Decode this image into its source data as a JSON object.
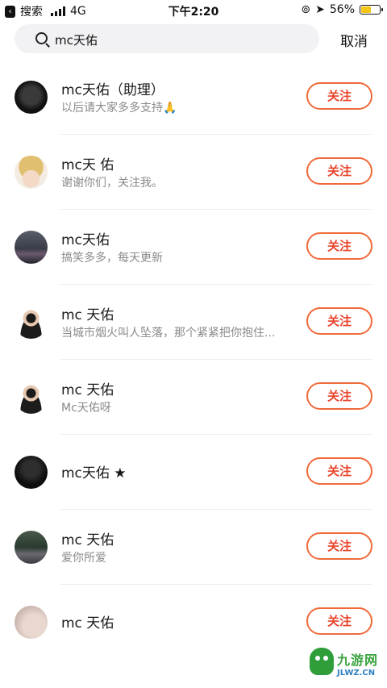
{
  "status_bar": {
    "back_app": "搜索",
    "network": "4G",
    "time": "下午2:20",
    "battery_percent": "56%",
    "battery_level": 0.56
  },
  "search": {
    "query": "mc天佑",
    "cancel_label": "取消"
  },
  "results": [
    {
      "name": "mc天佑（助理）",
      "desc": "以后请大家多多支持🙏",
      "follow_label": "关注"
    },
    {
      "name": "mc天 佑",
      "desc": "谢谢你们，关注我。",
      "follow_label": "关注"
    },
    {
      "name": "mc天佑",
      "desc": "搞笑多多，每天更新",
      "follow_label": "关注"
    },
    {
      "name": "mc 天佑",
      "desc": "当城市烟火叫人坠落，那个紧紧把你抱住...",
      "follow_label": "关注"
    },
    {
      "name": "mc 天佑",
      "desc": "Mc天佑呀",
      "follow_label": "关注"
    },
    {
      "name": "mc天佑 ★",
      "desc": "",
      "follow_label": "关注"
    },
    {
      "name": "mc 天佑",
      "desc": "爱你所爱",
      "follow_label": "关注"
    },
    {
      "name": "mc 天佑",
      "desc": "",
      "follow_label": "关注"
    }
  ],
  "watermark": {
    "text": "九游网",
    "url": "JLWZ.CN"
  },
  "colors": {
    "accent": "#e8452b",
    "follow_border": "#f06a3a",
    "search_bg": "#f2f2f4"
  }
}
